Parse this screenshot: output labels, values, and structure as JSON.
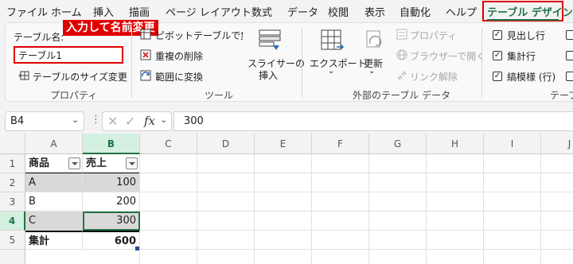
{
  "menu": {
    "tabs": [
      "ファイル",
      "ホーム",
      "挿入",
      "描画",
      "ページ レイアウト",
      "数式",
      "データ",
      "校閲",
      "表示",
      "自動化",
      "ヘルプ",
      "テーブル デザイン"
    ]
  },
  "ribbon": {
    "properties": {
      "table_name_label": "テーブル名:",
      "table_name_value": "テーブル1",
      "resize_label": "テーブルのサイズ変更",
      "group_label": "プロパティ"
    },
    "tools": {
      "pivot_label": "ピボットテーブルで集計",
      "remove_dup_label": "重複の削除",
      "convert_range_label": "範囲に変換",
      "slicer_label_line1": "スライサーの",
      "slicer_label_line2": "挿入",
      "group_label": "ツール"
    },
    "external": {
      "export_label": "エクスポート",
      "refresh_label": "更新",
      "properties_label": "プロパティ",
      "open_browser_label": "ブラウザーで開く",
      "unlink_label": "リンク解除",
      "group_label": "外部のテーブル データ"
    },
    "style_options": {
      "header_row_label": "見出し行",
      "total_row_label": "集計行",
      "banded_rows_label": "縞模様 (行)",
      "group_label": "テーブ"
    }
  },
  "annotation": {
    "text": "入力して名前変更"
  },
  "formula_bar": {
    "name_box": "B4",
    "formula": "300",
    "fx_label": "fx"
  },
  "sheet": {
    "columns": [
      "A",
      "B",
      "C",
      "D",
      "E",
      "F",
      "G",
      "H",
      "I",
      "J"
    ],
    "rows": [
      "1",
      "2",
      "3",
      "4",
      "5"
    ],
    "table_headers": [
      "商品",
      "売上"
    ],
    "table_rows": [
      {
        "product": "A",
        "sales": "100"
      },
      {
        "product": "B",
        "sales": "200"
      },
      {
        "product": "C",
        "sales": "300"
      }
    ],
    "total_label": "集計",
    "total_value": "600",
    "selected_cell": "B4"
  },
  "colors": {
    "accent": "#217346",
    "highlight_red": "#e00000",
    "band": "#d9d9d9"
  }
}
